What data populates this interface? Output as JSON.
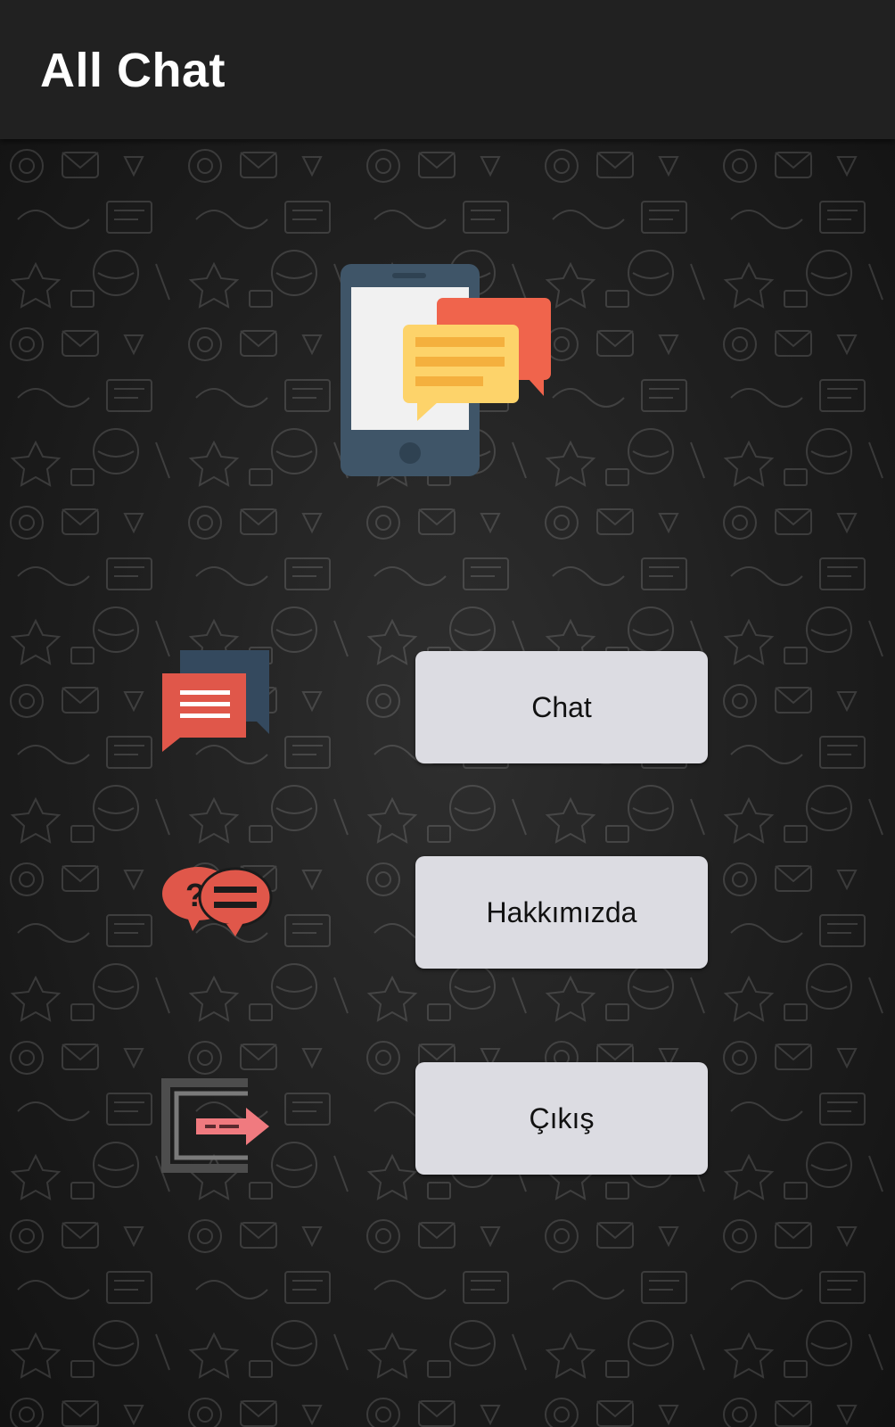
{
  "app_bar": {
    "title": "All Chat"
  },
  "hero": {
    "icon": "phone-chat-icon"
  },
  "menu": [
    {
      "label": "Chat",
      "icon": "chat-bubbles-icon"
    },
    {
      "label": "Hakkımızda",
      "icon": "question-chat-icon"
    },
    {
      "label": "Çıkış",
      "icon": "exit-icon"
    }
  ],
  "colors": {
    "app_bar": "#212121",
    "background": "#1b1b1b",
    "button": "#dcdce2",
    "accent_red": "#e0574a",
    "accent_yellow": "#fdd36a",
    "phone_body": "#3f5568"
  }
}
